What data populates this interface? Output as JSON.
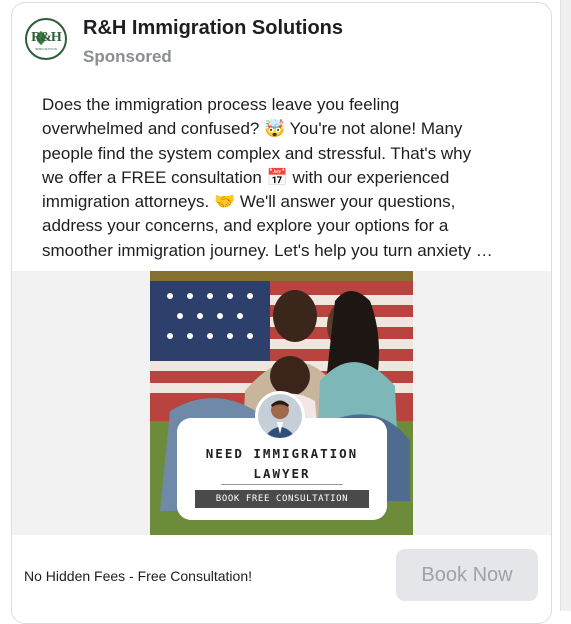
{
  "ad": {
    "page_name": "R&H Immigration Solutions",
    "sponsored_label": "Sponsored",
    "logo_text": "R&H",
    "logo_subtext": "IMMIGRATION",
    "body": "Does the immigration process leave you feeling\noverwhelmed and confused? 🤯 You're not alone! Many\npeople find the system complex and stressful. That's why\nwe offer a FREE consultation 📅 with our experienced\nimmigration attorneys. 🤝 We'll answer your questions,\naddress your concerns, and explore your options for a\nsmoother immigration journey. Let's help you turn anxiety …",
    "creative": {
      "title_line1": "NEED IMMIGRATION",
      "title_line2": "LAWYER",
      "button_text": "BOOK FREE CONSULTATION"
    },
    "footer": {
      "headline": "No Hidden Fees - Free Consultation!",
      "cta_label": "Book Now"
    }
  },
  "colors": {
    "brand_green": "#2f5d35",
    "cta_bg": "#e4e6e9",
    "cta_text": "#9ea2a8",
    "muted_text": "#8a8d91"
  }
}
